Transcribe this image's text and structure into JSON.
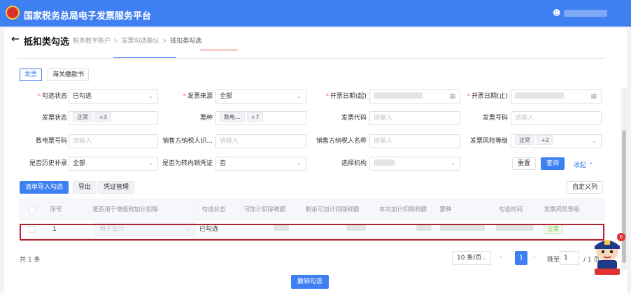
{
  "app": {
    "title": "国家税务总局电子发票服务平台",
    "user_icon": "user-icon"
  },
  "page": {
    "title": "抵扣类勾选",
    "back_icon": "arrow-left-icon",
    "breadcrumb": [
      "税务数字账户",
      "发票勾选确认",
      "抵扣类勾选"
    ]
  },
  "tabs": {
    "active": "抵扣类勾选"
  },
  "subtabs": [
    "发票",
    "海关缴款书"
  ],
  "filters": {
    "check_status": {
      "label": "勾选状态",
      "value": "已勾选"
    },
    "invoice_source": {
      "label": "发票来源",
      "value": "全部"
    },
    "issue_date_start": {
      "label": "开票日期(起)"
    },
    "issue_date_end": {
      "label": "开票日期(止)"
    },
    "invoice_status": {
      "label": "发票状态",
      "tag": "正常",
      "more": "+3"
    },
    "ticket_type": {
      "label": "票种",
      "tag": "数电...",
      "more": "+7"
    },
    "invoice_code": {
      "label": "发票代码",
      "placeholder": "请输入"
    },
    "invoice_number": {
      "label": "发票号码",
      "placeholder": "请输入"
    },
    "e_invoice_number": {
      "label": "数电票号码",
      "placeholder": "请输入"
    },
    "seller_tax_id": {
      "label": "销售方纳税人识...",
      "placeholder": "请输入"
    },
    "seller_name": {
      "label": "销售方纳税人名称",
      "placeholder": "请输入"
    },
    "risk_level": {
      "label": "发票风险等级",
      "tag": "正常",
      "more": "+2"
    },
    "history_supplement": {
      "label": "是否历史补录",
      "value": "全部"
    },
    "transfer_voucher": {
      "label": "是否为转内销凭证",
      "value": "否"
    },
    "org": {
      "label": "选择机构"
    }
  },
  "actions": {
    "reset": "重置",
    "query": "查询",
    "collapse": "收起",
    "import_check": "清单导入勾选",
    "export": "导出",
    "voucher_mgmt": "凭证管理",
    "custom_columns": "自定义列",
    "revoke": "撤销勾选"
  },
  "table": {
    "columns": [
      "序号",
      "是否用于增值税加计扣除",
      "勾选状态",
      "可加计扣除税额",
      "剩余可加计扣除税额",
      "本次加计扣除税额",
      "票种",
      "勾选时间",
      "发票风险等级"
    ],
    "rows": [
      {
        "index": "1",
        "usage": "用于加计",
        "check_status": "已勾选",
        "risk": "正常"
      }
    ]
  },
  "pagination": {
    "total": "共 1 条",
    "page_size": "10 条/页",
    "current": "1",
    "goto_label": "跳至",
    "goto_value": "1",
    "total_pages": "/ 1 页"
  },
  "notification_count": "6",
  "colors": {
    "primary": "#3e7ff2",
    "highlight_border": "#b0202a",
    "success": "#67c23a"
  }
}
